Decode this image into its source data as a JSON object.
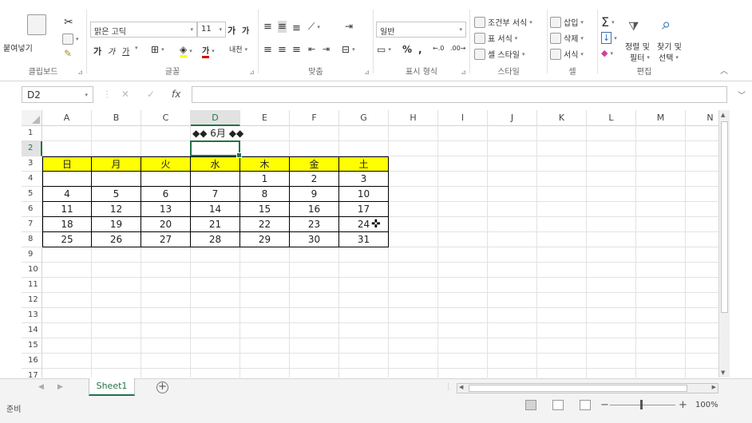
{
  "ribbon": {
    "clipboard": {
      "paste_label": "붙여넣기",
      "group_label": "클립보드"
    },
    "font": {
      "font_name": "맑은 고딕",
      "font_size": "11",
      "grow": "가",
      "shrink": "가",
      "bold": "가",
      "italic": "가",
      "underline": "가",
      "font_color_glyph": "가",
      "phonetic": "내천",
      "group_label": "글꼴"
    },
    "alignment": {
      "group_label": "맞춤"
    },
    "number": {
      "format_value": "일반",
      "percent": "%",
      "comma": ",",
      "group_label": "표시 형식"
    },
    "styles": {
      "conditional": "조건부 서식",
      "table": "표 서식",
      "cell_style": "셀 스타일",
      "group_label": "스타일"
    },
    "cells": {
      "insert": "삽입",
      "delete": "삭제",
      "format": "서식",
      "group_label": "셀"
    },
    "editing": {
      "sort_filter_1": "정렬 및",
      "sort_filter_2": "필터",
      "find_select_1": "찾기 및",
      "find_select_2": "선택",
      "group_label": "편집"
    }
  },
  "formula_bar": {
    "name_box": "D2",
    "fx": "fx",
    "formula": ""
  },
  "grid": {
    "columns": [
      "A",
      "B",
      "C",
      "D",
      "E",
      "F",
      "G",
      "H",
      "I",
      "J",
      "K",
      "L",
      "M",
      "N"
    ],
    "rows": [
      "1",
      "2",
      "3",
      "4",
      "5",
      "6",
      "7",
      "8",
      "9",
      "10",
      "11",
      "12",
      "13",
      "14",
      "15",
      "16",
      "17"
    ],
    "active_cell": "D2"
  },
  "calendar": {
    "title": "◆◆  6月  ◆◆",
    "headers": [
      "日",
      "月",
      "火",
      "水",
      "木",
      "金",
      "土"
    ],
    "weeks": [
      [
        "",
        "",
        "",
        "",
        "1",
        "2",
        "3"
      ],
      [
        "4",
        "5",
        "6",
        "7",
        "8",
        "9",
        "10"
      ],
      [
        "11",
        "12",
        "13",
        "14",
        "15",
        "16",
        "17"
      ],
      [
        "18",
        "19",
        "20",
        "21",
        "22",
        "23",
        "24"
      ],
      [
        "25",
        "26",
        "27",
        "28",
        "29",
        "30",
        "31"
      ]
    ]
  },
  "sheets": {
    "active_tab": "Sheet1"
  },
  "status": {
    "mode": "준비",
    "zoom": "100%"
  },
  "colors": {
    "accent": "#217346",
    "header_fill": "#ffff00"
  }
}
